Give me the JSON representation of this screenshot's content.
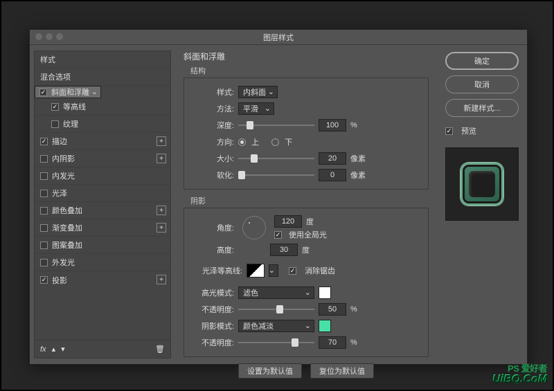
{
  "title": "图层样式",
  "left": {
    "styles": "样式",
    "blend": "混合选项",
    "items": [
      {
        "label": "斜面和浮雕",
        "on": true,
        "sel": true,
        "plus": false,
        "sub": false
      },
      {
        "label": "等高线",
        "on": true,
        "sel": false,
        "plus": false,
        "sub": true
      },
      {
        "label": "纹理",
        "on": false,
        "sel": false,
        "plus": false,
        "sub": true
      },
      {
        "label": "描边",
        "on": true,
        "sel": false,
        "plus": true,
        "sub": false
      },
      {
        "label": "内阴影",
        "on": false,
        "sel": false,
        "plus": true,
        "sub": false
      },
      {
        "label": "内发光",
        "on": false,
        "sel": false,
        "plus": false,
        "sub": false
      },
      {
        "label": "光泽",
        "on": false,
        "sel": false,
        "plus": false,
        "sub": false
      },
      {
        "label": "颜色叠加",
        "on": false,
        "sel": false,
        "plus": true,
        "sub": false
      },
      {
        "label": "渐变叠加",
        "on": false,
        "sel": false,
        "plus": true,
        "sub": false
      },
      {
        "label": "图案叠加",
        "on": false,
        "sel": false,
        "plus": false,
        "sub": false
      },
      {
        "label": "外发光",
        "on": false,
        "sel": false,
        "plus": false,
        "sub": false
      },
      {
        "label": "投影",
        "on": true,
        "sel": false,
        "plus": true,
        "sub": false
      }
    ],
    "fx": "fx"
  },
  "mid": {
    "heading": "斜面和浮雕",
    "structure": "结构",
    "style_lbl": "样式:",
    "style_val": "内斜面",
    "method_lbl": "方法:",
    "method_val": "平滑",
    "depth_lbl": "深度:",
    "depth_val": "100",
    "pct": "%",
    "dir_lbl": "方向:",
    "up": "上",
    "down": "下",
    "size_lbl": "大小:",
    "size_val": "20",
    "px": "像素",
    "soft_lbl": "软化:",
    "soft_val": "0",
    "shadow": "阴影",
    "angle_lbl": "角度:",
    "angle_val": "120",
    "deg": "度",
    "global": "使用全局光",
    "alt_lbl": "高度:",
    "alt_val": "30",
    "gloss_lbl": "光泽等高线:",
    "aa": "消除锯齿",
    "hmode_lbl": "高光模式:",
    "hmode_val": "滤色",
    "hopac_lbl": "不透明度:",
    "hopac_val": "50",
    "smode_lbl": "阴影模式:",
    "smode_val": "颜色减淡",
    "sopac_lbl": "不透明度:",
    "sopac_val": "70",
    "set_default": "设置为默认值",
    "reset_default": "复位为默认值",
    "hcolor": "#ffffff",
    "scolor": "#49e0a8"
  },
  "right": {
    "ok": "确定",
    "cancel": "取消",
    "new": "新建样式...",
    "preview": "预览"
  },
  "watermark": {
    "a": "PS 爱好者",
    "b": "UiBQ.CoM"
  }
}
